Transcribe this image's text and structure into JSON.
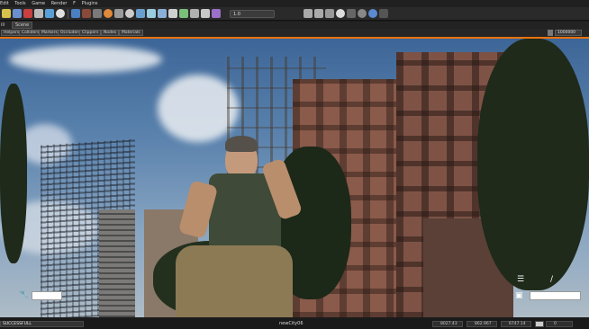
{
  "menu": [
    "Edit",
    "Tools",
    "Game",
    "Render",
    "F",
    "Plugins"
  ],
  "toolbar": {
    "select_value": "1.0"
  },
  "view": {
    "label": "ill",
    "tab": "Scene"
  },
  "filters": [
    "Helpers",
    "Colliders",
    "Markers",
    "Occluders",
    "Clippers",
    "Nodes",
    "Materials"
  ],
  "filter_right": "1000000",
  "hud": {
    "slash": "/"
  },
  "status": {
    "left": "SUCCESSFULL",
    "center": "newCity06",
    "field1": "8027.43",
    "field2": "862.967",
    "field3": "6747.14",
    "field4": "0"
  },
  "colors": {
    "accent": "#e8730e"
  }
}
